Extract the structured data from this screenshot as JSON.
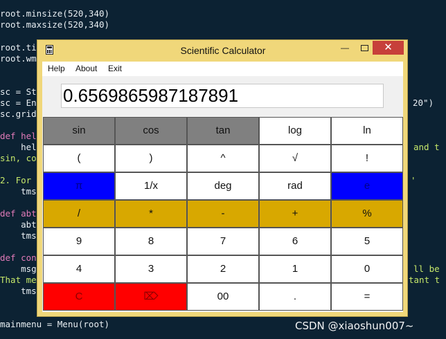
{
  "background_code": [
    {
      "text": "root.minsize(520,340)"
    },
    {
      "text": "root.maxsize(520,340)"
    },
    {
      "text": "root.ti"
    },
    {
      "text": "root.wm"
    },
    {
      "text": "sc = St"
    },
    {
      "text": "sc = En"
    },
    {
      "text": "sc.grid"
    },
    {
      "text": "def hel"
    },
    {
      "text": "    hel"
    },
    {
      "text": "sin, co"
    },
    {
      "text": "2. For"
    },
    {
      "text": "    tms"
    },
    {
      "text": "def abt"
    },
    {
      "text": "    abt"
    },
    {
      "text": "    tms"
    },
    {
      "text": "def con"
    },
    {
      "text": "    msg"
    },
    {
      "text": "That me"
    },
    {
      "text": "    tms"
    },
    {
      "text": "mainmenu = Menu(root)"
    },
    {
      "text": "20\")"
    },
    {
      "text": "and t"
    },
    {
      "text": "'"
    },
    {
      "text": "ll be"
    },
    {
      "text": "tant t"
    }
  ],
  "window": {
    "title": "Scientific Calculator",
    "minimize_glyph": "—",
    "close_glyph": "✕"
  },
  "menu": {
    "items": [
      "Help",
      "About",
      "Exit"
    ]
  },
  "display": {
    "value": "0.6569865987187891"
  },
  "keys": [
    {
      "label": "sin",
      "style": "gray"
    },
    {
      "label": "cos",
      "style": "gray"
    },
    {
      "label": "tan",
      "style": "gray"
    },
    {
      "label": "log",
      "style": "white"
    },
    {
      "label": "ln",
      "style": "white"
    },
    {
      "label": "(",
      "style": "white"
    },
    {
      "label": ")",
      "style": "white"
    },
    {
      "label": "^",
      "style": "white"
    },
    {
      "label": "√",
      "style": "white"
    },
    {
      "label": "!",
      "style": "white"
    },
    {
      "label": "π",
      "style": "blue"
    },
    {
      "label": "1/x",
      "style": "white"
    },
    {
      "label": "deg",
      "style": "white"
    },
    {
      "label": "rad",
      "style": "white"
    },
    {
      "label": "e",
      "style": "blue"
    },
    {
      "label": "/",
      "style": "gold"
    },
    {
      "label": "*",
      "style": "gold"
    },
    {
      "label": "-",
      "style": "gold"
    },
    {
      "label": "+",
      "style": "gold"
    },
    {
      "label": "%",
      "style": "gold"
    },
    {
      "label": "9",
      "style": "white"
    },
    {
      "label": "8",
      "style": "white"
    },
    {
      "label": "7",
      "style": "white"
    },
    {
      "label": "6",
      "style": "white"
    },
    {
      "label": "5",
      "style": "white"
    },
    {
      "label": "4",
      "style": "white"
    },
    {
      "label": "3",
      "style": "white"
    },
    {
      "label": "2",
      "style": "white"
    },
    {
      "label": "1",
      "style": "white"
    },
    {
      "label": "0",
      "style": "white"
    },
    {
      "label": "C",
      "style": "red"
    },
    {
      "label": "⌦",
      "style": "red"
    },
    {
      "label": "00",
      "style": "white"
    },
    {
      "label": ".",
      "style": "white"
    },
    {
      "label": "=",
      "style": "white"
    }
  ],
  "watermark": "CSDN @xiaoshun007~",
  "colors": {
    "editor_bg": "#0c2233",
    "window_frame": "#f0d77a",
    "gray_key": "#808080",
    "blue_key": "#0000ff",
    "gold_key": "#d8a800",
    "red_key": "#ff0000"
  }
}
